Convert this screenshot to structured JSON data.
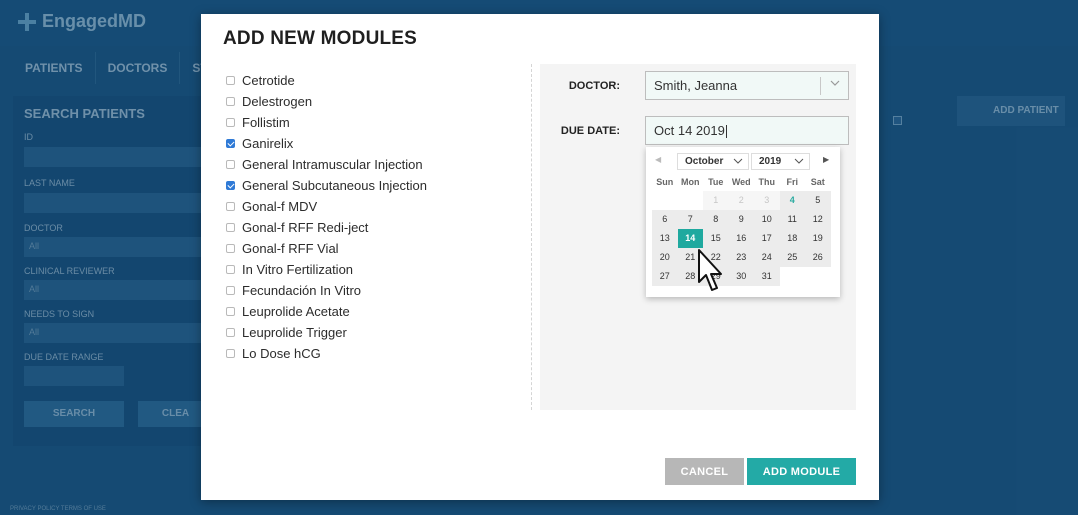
{
  "background_app": {
    "logo_text": "EngagedMD",
    "nav": [
      "PATIENTS",
      "DOCTORS",
      "ST"
    ],
    "search_title": "SEARCH PATIENTS",
    "labels": {
      "id": "ID",
      "last_name": "LAST NAME",
      "doctor": "DOCTOR",
      "clinical_reviewer": "CLINICAL REVIEWER",
      "needs_to_sign": "NEEDS TO SIGN",
      "due_date_range": "DUE DATE RANGE"
    },
    "select_all": "All",
    "search_button": "SEARCH",
    "clear_button": "CLEA",
    "add_patient": "ADD PATIENT",
    "footer": "PRIVACY POLICY    TERMS OF USE"
  },
  "modal": {
    "title": "ADD NEW MODULES",
    "modules": [
      {
        "label": "Cetrotide",
        "checked": false
      },
      {
        "label": "Delestrogen",
        "checked": false
      },
      {
        "label": "Follistim",
        "checked": false
      },
      {
        "label": "Ganirelix",
        "checked": true
      },
      {
        "label": "General Intramuscular Injection",
        "checked": false
      },
      {
        "label": "General Subcutaneous Injection",
        "checked": true
      },
      {
        "label": "Gonal-f MDV",
        "checked": false
      },
      {
        "label": "Gonal-f RFF Redi-ject",
        "checked": false
      },
      {
        "label": "Gonal-f RFF Vial",
        "checked": false
      },
      {
        "label": "In Vitro Fertilization",
        "checked": false
      },
      {
        "label": "Fecundación In Vitro",
        "checked": false
      },
      {
        "label": "Leuprolide Acetate",
        "checked": false
      },
      {
        "label": "Leuprolide Trigger",
        "checked": false
      },
      {
        "label": "Lo Dose hCG",
        "checked": false
      }
    ],
    "doctor_label": "DOCTOR:",
    "doctor_value": "Smith, Jeanna",
    "due_date_label": "DUE DATE:",
    "due_date_value": "Oct 14 2019",
    "cancel_label": "CANCEL",
    "add_label": "ADD MODULE"
  },
  "datepicker": {
    "month": "October",
    "year": "2019",
    "weekdays": [
      "Sun",
      "Mon",
      "Tue",
      "Wed",
      "Thu",
      "Fri",
      "Sat"
    ],
    "rows": [
      [
        "",
        "",
        "1",
        "2",
        "3",
        "4",
        "5"
      ],
      [
        "6",
        "7",
        "8",
        "9",
        "10",
        "11",
        "12"
      ],
      [
        "13",
        "14",
        "15",
        "16",
        "17",
        "18",
        "19"
      ],
      [
        "20",
        "21",
        "22",
        "23",
        "24",
        "25",
        "26"
      ],
      [
        "27",
        "28",
        "29",
        "30",
        "31",
        "",
        ""
      ]
    ],
    "muted_days": [
      "1",
      "2",
      "3"
    ],
    "today": "4",
    "selected": "14",
    "accent_color": "#1fa99f"
  }
}
